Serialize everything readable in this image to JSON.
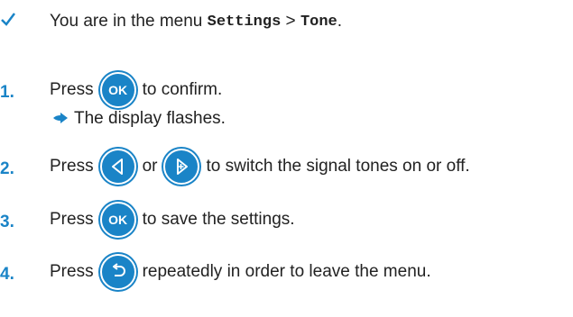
{
  "prereq": {
    "check_icon": "check-icon",
    "text_before": "You are in the menu ",
    "menu_1": "Settings",
    "separator": " > ",
    "menu_2": "Tone",
    "text_after": "."
  },
  "steps": [
    {
      "number": "1.",
      "press": "Press",
      "button_label": "OK",
      "after": "to confirm."
    },
    {
      "result_icon": "arrow-right-icon",
      "result": "The display flashes."
    },
    {
      "number": "2.",
      "press": "Press",
      "or": "or",
      "after": "to switch the signal tones on or off."
    },
    {
      "number": "3.",
      "press": "Press",
      "button_label": "OK",
      "after": "to save the settings."
    },
    {
      "number": "4.",
      "press": "Press",
      "after": "repeatedly in order to leave the menu."
    }
  ],
  "colors": {
    "accent": "#1a84c7",
    "text": "#222222"
  }
}
